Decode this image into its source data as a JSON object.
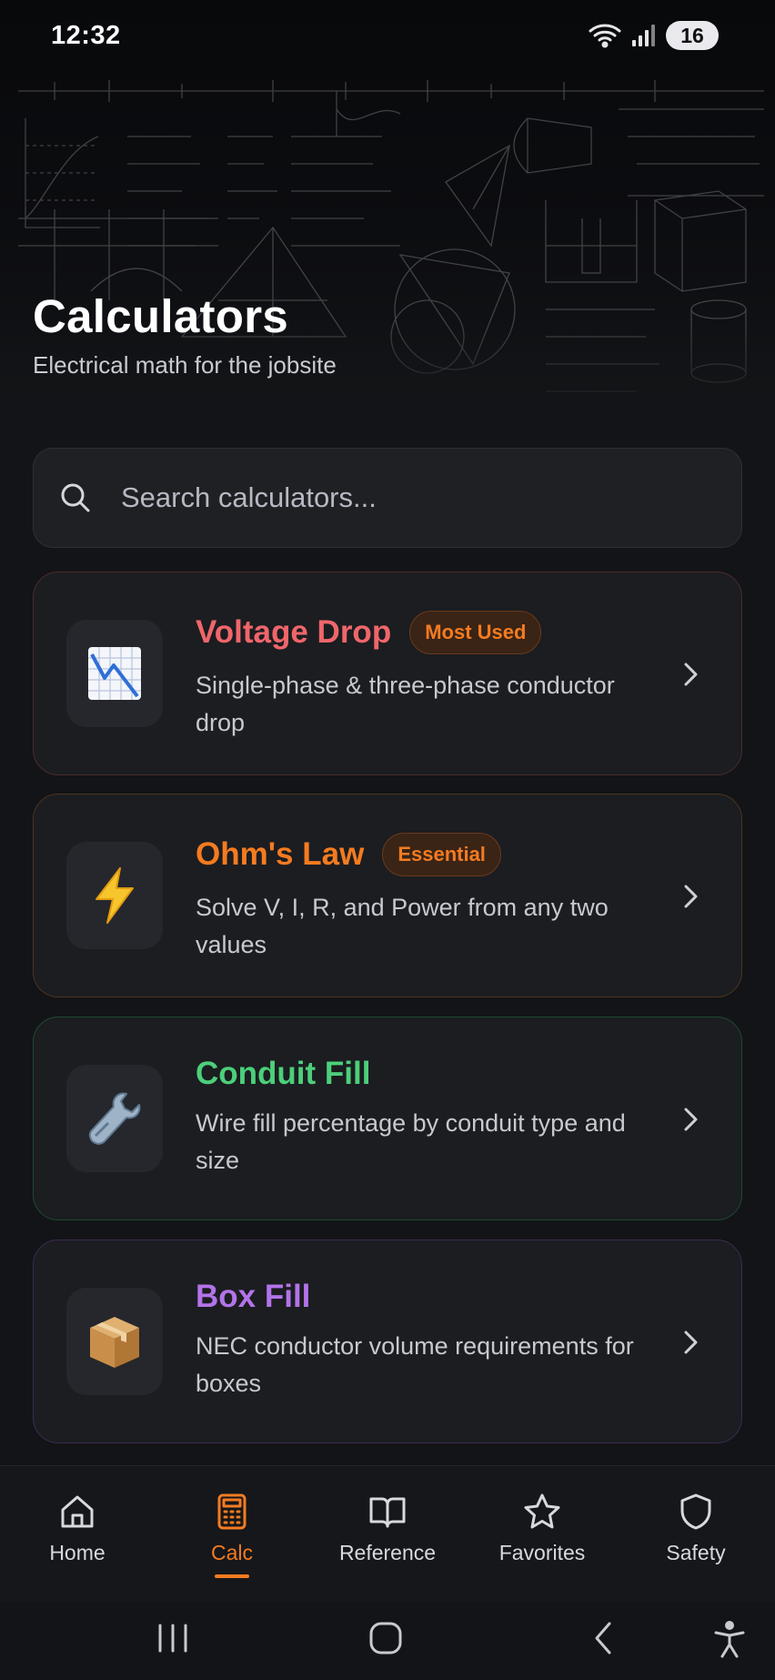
{
  "status_bar": {
    "time": "12:32",
    "battery": "16"
  },
  "hero": {
    "title": "Calculators",
    "subtitle": "Electrical math for the jobsite"
  },
  "search": {
    "placeholder": "Search calculators..."
  },
  "cards": [
    {
      "title": "Voltage Drop",
      "badge": "Most Used",
      "description": "Single-phase & three-phase conductor drop",
      "icon": "chart-decreasing-icon",
      "accent": "#f0666a"
    },
    {
      "title": "Ohm's Law",
      "badge": "Essential",
      "description": "Solve V, I, R, and Power from any two values",
      "icon": "lightning-icon",
      "accent": "#f47b20"
    },
    {
      "title": "Conduit Fill",
      "badge": "",
      "description": "Wire fill percentage by conduit type and size",
      "icon": "wrench-icon",
      "accent": "#4ccf7a"
    },
    {
      "title": "Box Fill",
      "badge": "",
      "description": "NEC conductor volume requirements for boxes",
      "icon": "package-icon",
      "accent": "#b373e8"
    }
  ],
  "tabs": [
    {
      "label": "Home",
      "icon": "home-icon",
      "active": false
    },
    {
      "label": "Calc",
      "icon": "calculator-icon",
      "active": true
    },
    {
      "label": "Reference",
      "icon": "book-icon",
      "active": false
    },
    {
      "label": "Favorites",
      "icon": "star-icon",
      "active": false
    },
    {
      "label": "Safety",
      "icon": "shield-icon",
      "active": false
    }
  ],
  "colors": {
    "background": "#131417",
    "card": "#1b1d21",
    "accent_active_tab": "#f47b20"
  }
}
